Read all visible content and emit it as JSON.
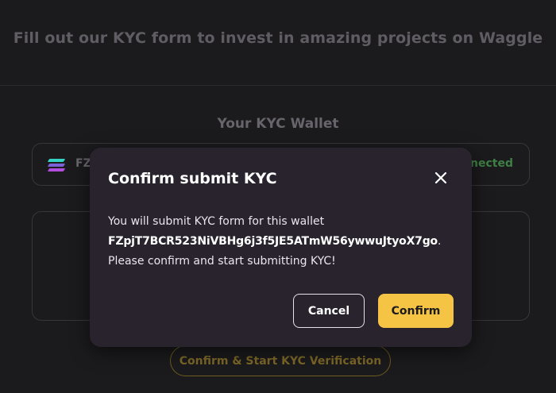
{
  "page": {
    "header_text": "Fill out our KYC form to invest in amazing projects on Waggle",
    "section_title": "Your KYC Wallet",
    "wallet": {
      "address_short": "FZ",
      "status": "nected",
      "icon": "solana-logo-icon"
    },
    "start_button_label": "Confirm & Start KYC Verification"
  },
  "modal": {
    "title": "Confirm submit KYC",
    "close_icon": "close-icon",
    "body_line1": "You will submit KYC form for this wallet",
    "wallet_address": "FZpjT7BCR523NiVBHg6j3f5JE5ATmW56ywwuJtyoX7go",
    "address_suffix": ".",
    "body_line3": "Please confirm and start submitting KYC!",
    "cancel_label": "Cancel",
    "confirm_label": "Confirm"
  },
  "colors": {
    "background": "#1b1a1c",
    "modal_bg": "#29232e",
    "accent": "#f6c444",
    "status_green": "#3f7f45"
  }
}
